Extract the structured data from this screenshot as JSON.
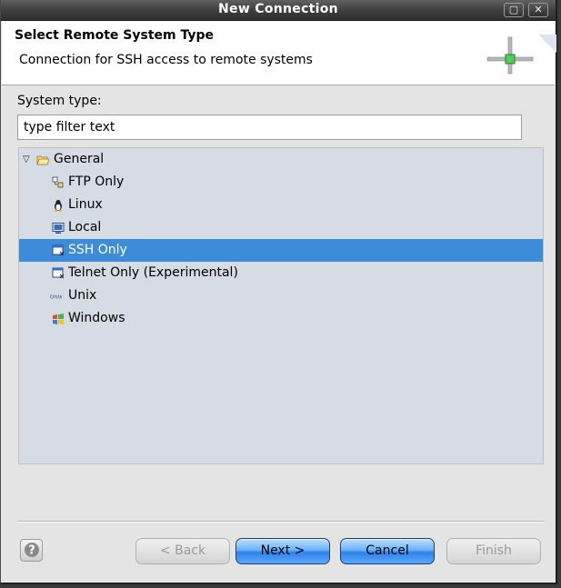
{
  "window": {
    "title": "New Connection",
    "controls": {
      "maximize": "▢",
      "close": "✕"
    }
  },
  "header": {
    "title": "Select Remote System Type",
    "description": "Connection for SSH access to remote systems",
    "icon": "connection-tee-icon"
  },
  "filter": {
    "label": "System type:",
    "value": "type filter text"
  },
  "tree": {
    "root": {
      "label": "General",
      "icon": "folder-open-icon",
      "expanded": true
    },
    "items": [
      {
        "label": "FTP Only",
        "icon": "ftp-icon",
        "selected": false
      },
      {
        "label": "Linux",
        "icon": "tux-icon",
        "selected": false
      },
      {
        "label": "Local",
        "icon": "monitor-icon",
        "selected": false
      },
      {
        "label": "SSH Only",
        "icon": "ssh-terminal-icon",
        "selected": true
      },
      {
        "label": "Telnet Only (Experimental)",
        "icon": "telnet-terminal-icon",
        "selected": false
      },
      {
        "label": "Unix",
        "icon": "unix-icon",
        "selected": false
      },
      {
        "label": "Windows",
        "icon": "windows-flag-icon",
        "selected": false
      }
    ]
  },
  "buttons": {
    "help": "?",
    "back": "< Back",
    "next": "Next >",
    "cancel": "Cancel",
    "finish": "Finish"
  },
  "colors": {
    "selection": "#3c8cda",
    "tree_background": "#d6dce4",
    "primary_button": "#5aa8ff"
  }
}
